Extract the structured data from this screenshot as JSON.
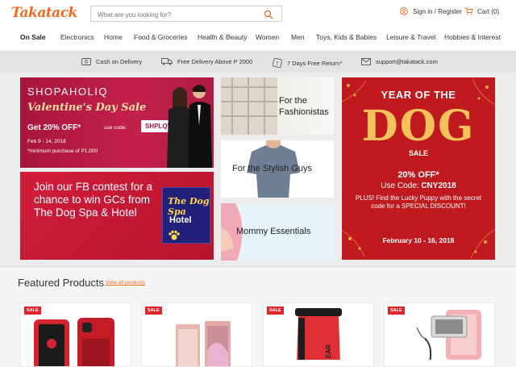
{
  "header": {
    "logo": "Takatack",
    "search_placeholder": "What are you looking for?",
    "account_label": "Sign in / Register",
    "cart_label": "Cart (0)"
  },
  "nav": [
    "On Sale",
    "Electronics",
    "Home",
    "Food & Groceries",
    "Health & Beauty",
    "Women",
    "Men",
    "Toys, Kids & Babies",
    "Leisure & Travel",
    "Hobbies & Interest"
  ],
  "perks": [
    "Cash on Delivery",
    "Free Delivery Above P 2000",
    "7 Days Free Return*",
    "support@takatack.com"
  ],
  "banners": {
    "shopaholiq": {
      "brand": "SHOPAHOLIQ",
      "headline": "Valentine's Day Sale",
      "offer": "Get 20% OFF*",
      "use_code": "use code:",
      "code": "SHPLQVDAY",
      "dates": "Feb 9 - 14, 2018",
      "note": "*minimum purchase of P1,000"
    },
    "fb_contest": {
      "text": "Join our FB contest for a chance to win GCs from The Dog Spa & Hotel",
      "logo_line1": "The Dog Spa",
      "logo_line2": "Hotel"
    },
    "fashionistas": "For the Fashionistas",
    "stylish_guys": "For the Stylish Guys",
    "mommy": "Mommy Essentials",
    "year_of_dog": {
      "line1": "YEAR OF THE",
      "big": "DOG",
      "sale": "SALE",
      "offer": "20% OFF*",
      "code_label": "Use Code:",
      "code": "CNY2018",
      "plus": "PLUS! Find the Lucky Puppy with the secret code for a SPECIAL DISCOUNT!",
      "dates": "February 10 - 16, 2018"
    }
  },
  "featured": {
    "title": "Featured Products",
    "view_all": "View all products",
    "products": [
      {
        "badge": "SALE",
        "icon": "phone-case-icon"
      },
      {
        "badge": "SALE",
        "icon": "smartphone-icon"
      },
      {
        "badge": "SALE",
        "icon": "dry-bag-icon"
      },
      {
        "badge": "SALE",
        "icon": "selfie-stick-icon"
      }
    ]
  },
  "colors": {
    "brand": "#f26a21",
    "sale_badge": "#e0242a",
    "banner_red": "#c01a1f"
  }
}
